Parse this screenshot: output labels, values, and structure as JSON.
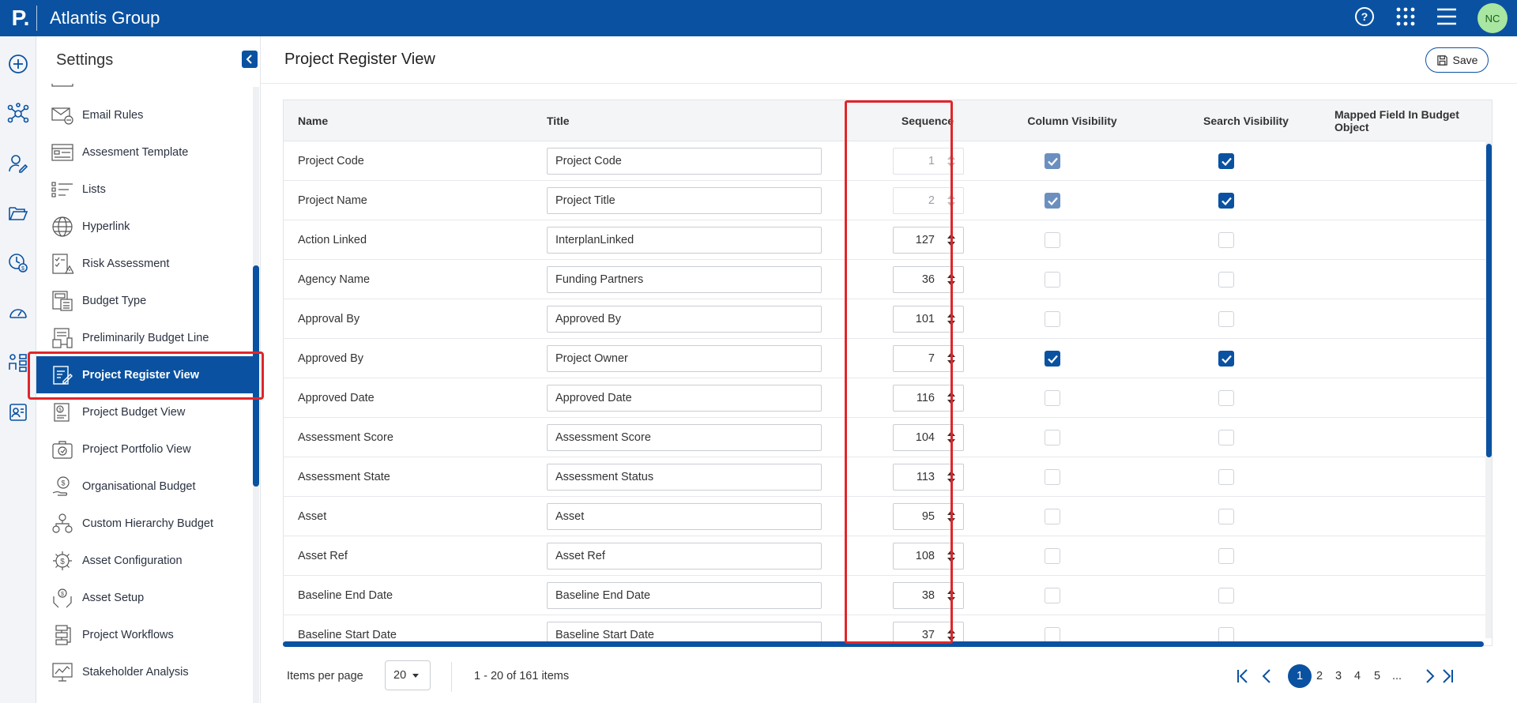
{
  "app": {
    "org_name": "Atlantis Group",
    "logo_letter": "P.",
    "avatar_initials": "NC"
  },
  "colors": {
    "brand": "#0a52a1",
    "highlight": "#e0262a",
    "avatar_bg": "#a8e6a1"
  },
  "sidebar": {
    "title": "Settings",
    "items": [
      {
        "label": "Email Rules",
        "icon": "envelope-rules-icon"
      },
      {
        "label": "Assesment Template",
        "icon": "template-icon"
      },
      {
        "label": "Lists",
        "icon": "list-icon"
      },
      {
        "label": "Hyperlink",
        "icon": "globe-icon"
      },
      {
        "label": "Risk Assessment",
        "icon": "risk-checklist-icon"
      },
      {
        "label": "Budget Type",
        "icon": "calculator-icon"
      },
      {
        "label": "Preliminarily Budget Line",
        "icon": "budget-line-icon"
      },
      {
        "label": "Project Register View",
        "icon": "register-edit-icon",
        "active": true
      },
      {
        "label": "Project Budget View",
        "icon": "budget-doc-icon"
      },
      {
        "label": "Project Portfolio View",
        "icon": "portfolio-icon"
      },
      {
        "label": "Organisational Budget",
        "icon": "money-hand-icon"
      },
      {
        "label": "Custom Hierarchy Budget",
        "icon": "hierarchy-coins-icon"
      },
      {
        "label": "Asset Configuration",
        "icon": "gear-dollar-icon"
      },
      {
        "label": "Asset Setup",
        "icon": "hands-coin-icon"
      },
      {
        "label": "Project Workflows",
        "icon": "workflow-icon"
      },
      {
        "label": "Stakeholder Analysis",
        "icon": "chart-board-icon"
      }
    ]
  },
  "main": {
    "title": "Project Register View",
    "save_label": "Save",
    "columns": {
      "name": "Name",
      "title": "Title",
      "sequence": "Sequence",
      "column_visibility": "Column Visibility",
      "search_visibility": "Search Visibility",
      "mapped": "Mapped Field In Budget Object"
    },
    "rows": [
      {
        "name": "Project Code",
        "title": "Project Code",
        "sequence": "1",
        "seq_disabled": true,
        "col_vis": true,
        "col_vis_dim": true,
        "search_vis": true
      },
      {
        "name": "Project Name",
        "title": "Project Title",
        "sequence": "2",
        "seq_disabled": true,
        "col_vis": true,
        "col_vis_dim": true,
        "search_vis": true
      },
      {
        "name": "Action Linked",
        "title": "InterplanLinked",
        "sequence": "127",
        "col_vis": false,
        "search_vis": false
      },
      {
        "name": "Agency Name",
        "title": "Funding Partners",
        "sequence": "36",
        "col_vis": false,
        "search_vis": false
      },
      {
        "name": "Approval By",
        "title": "Approved By",
        "sequence": "101",
        "col_vis": false,
        "search_vis": false
      },
      {
        "name": "Approved By",
        "title": "Project Owner",
        "sequence": "7",
        "col_vis": true,
        "search_vis": true
      },
      {
        "name": "Approved Date",
        "title": "Approved Date",
        "sequence": "116",
        "col_vis": false,
        "search_vis": false
      },
      {
        "name": "Assessment Score",
        "title": "Assessment Score",
        "sequence": "104",
        "col_vis": false,
        "search_vis": false
      },
      {
        "name": "Assessment State",
        "title": "Assessment Status",
        "sequence": "113",
        "col_vis": false,
        "search_vis": false
      },
      {
        "name": "Asset",
        "title": "Asset",
        "sequence": "95",
        "col_vis": false,
        "search_vis": false
      },
      {
        "name": "Asset Ref",
        "title": "Asset Ref",
        "sequence": "108",
        "col_vis": false,
        "search_vis": false
      },
      {
        "name": "Baseline End Date",
        "title": "Baseline End Date",
        "sequence": "38",
        "col_vis": false,
        "search_vis": false
      },
      {
        "name": "Baseline Start Date",
        "title": "Baseline Start Date",
        "sequence": "37",
        "col_vis": false,
        "search_vis": false
      }
    ]
  },
  "footer": {
    "items_per_page_label": "Items per page",
    "items_per_page_value": "20",
    "range_text": "1 - 20 of 161 items",
    "pages": [
      "1",
      "2",
      "3",
      "4",
      "5",
      "..."
    ],
    "current_page": "1"
  }
}
